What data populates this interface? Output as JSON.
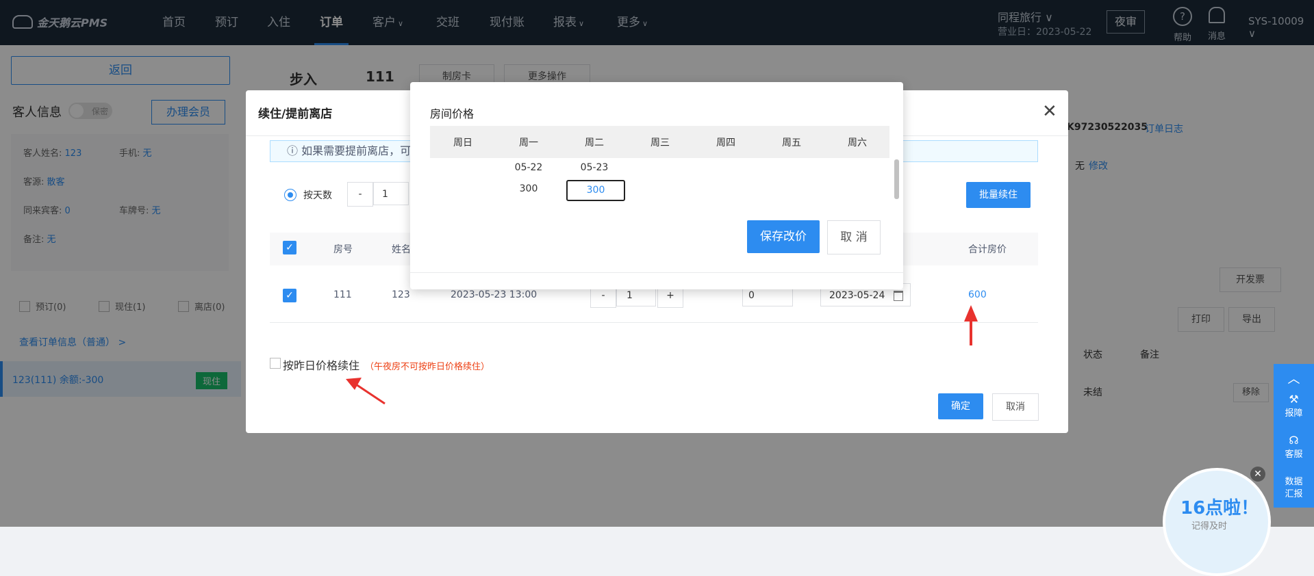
{
  "nav": {
    "logo": "金天鹅云PMS",
    "items": [
      {
        "label": "首页",
        "caret": ""
      },
      {
        "label": "预订",
        "caret": ""
      },
      {
        "label": "入住",
        "caret": ""
      },
      {
        "label": "订单",
        "caret": ""
      },
      {
        "label": "客户",
        "caret": "∨"
      },
      {
        "label": "交班",
        "caret": ""
      },
      {
        "label": "现付账",
        "caret": ""
      },
      {
        "label": "报表",
        "caret": "∨"
      },
      {
        "label": "更多",
        "caret": "∨"
      }
    ],
    "hotel": "同程旅行 ∨",
    "business_date": "营业日：2023-05-22",
    "night_audit": "夜审",
    "help": "帮助",
    "messages": "消息",
    "user": "SYS-10009 ∨"
  },
  "sidebar": {
    "back": "返回",
    "guest_info": "客人信息",
    "toggle_label": "保密",
    "member_button": "办理会员",
    "name_label": "客人姓名:",
    "name_value": "123",
    "phone_label": "手机:",
    "phone_value": "无",
    "source_label": "客源:",
    "source_value": "散客",
    "companions_label": "同来宾客:",
    "companions_value": "0",
    "plate_label": "车牌号:",
    "plate_value": "无",
    "remark_label": "备注:",
    "remark_value": "无",
    "filters": [
      "预订(0)",
      "现住(1)",
      "离店(0)"
    ],
    "order_link": "查看订单信息（普通）  >",
    "room_row": "123(111)  余额:-300",
    "room_badge": "现住"
  },
  "main": {
    "walkin": "步入",
    "room": "111",
    "make_card": "制房卡",
    "more_ops": "更多操作",
    "order_no": "K97230522035",
    "order_log": "订单日志",
    "none": "无",
    "modify": "修改",
    "invoice": "开发票",
    "print": "打印",
    "export": "导出",
    "col_status": "状态",
    "col_remark": "备注",
    "status_value": "未结",
    "remove": "移除"
  },
  "dialog": {
    "title": "续住/提前离店",
    "close": "✕",
    "info": "ⓘ 如果需要提前离店，可",
    "by_days": "按天数",
    "minus": "-",
    "days": "1",
    "batch": "批量续住",
    "headers": {
      "room": "房号",
      "name": "姓名",
      "total": "合计房价"
    },
    "row": {
      "room": "111",
      "name": "123",
      "arrive": "2023-05-23 13:00",
      "minus": "-",
      "nights": "1",
      "plus": "+",
      "extra": "0",
      "depart": "2023-05-24",
      "total": "600"
    },
    "yesterday_price": "按昨日价格续住",
    "yesterday_note": "（午夜房不可按昨日价格续住）",
    "confirm": "确定",
    "cancel": "取消"
  },
  "room_price": {
    "title": "房间价格",
    "weekdays": [
      "周日",
      "周一",
      "周二",
      "周三",
      "周四",
      "周五",
      "周六"
    ],
    "dates": [
      "05-22",
      "05-23"
    ],
    "prices": [
      "300",
      "300"
    ],
    "save": "保存改价",
    "cancel": "取 消"
  },
  "float": {
    "report": "报障",
    "service": "客服",
    "data": "数据\n汇报",
    "bubble_title": "16点啦！",
    "bubble_sub": "记得及时"
  },
  "colors": {
    "accent": "#2d8cf0",
    "nav_bg": "#1c2b3a",
    "arrow": "#e8322e"
  }
}
